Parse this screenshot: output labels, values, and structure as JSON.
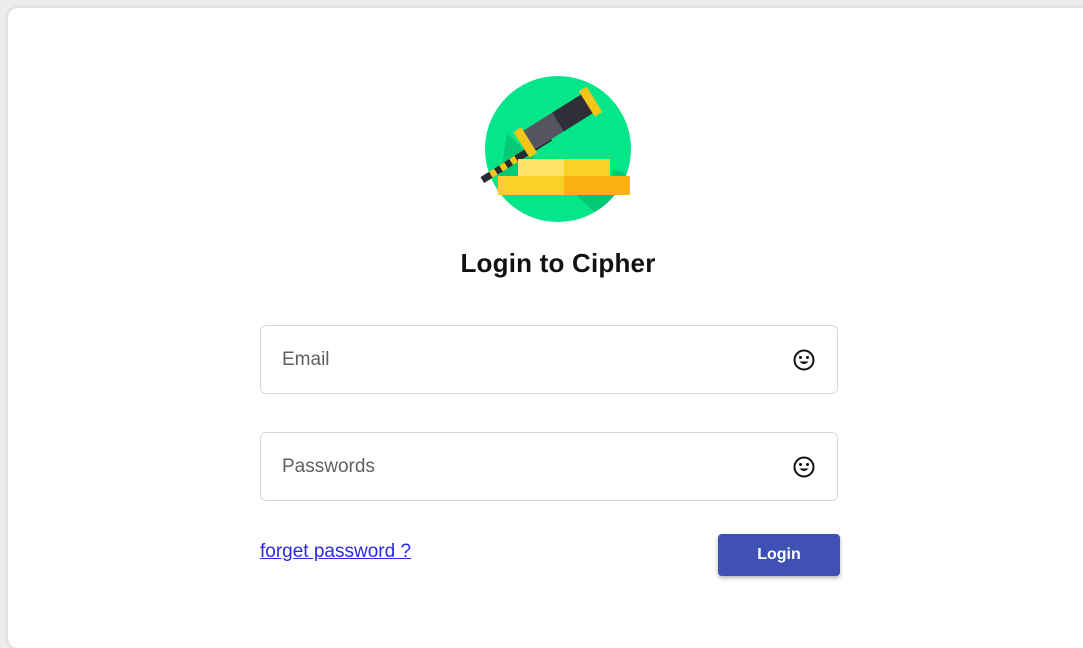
{
  "header": {
    "logo_icon": "gavel-icon",
    "title": "Login to Cipher"
  },
  "form": {
    "email": {
      "placeholder": "Email",
      "value": "",
      "icon": "smiley-icon"
    },
    "password": {
      "placeholder": "Passwords",
      "value": "",
      "icon": "smiley-icon"
    },
    "forget_link": "forget password ?",
    "login_label": "Login"
  },
  "colors": {
    "logo_circle": "#05e68a",
    "button": "#3f51b5",
    "link": "#2a2ae8"
  }
}
